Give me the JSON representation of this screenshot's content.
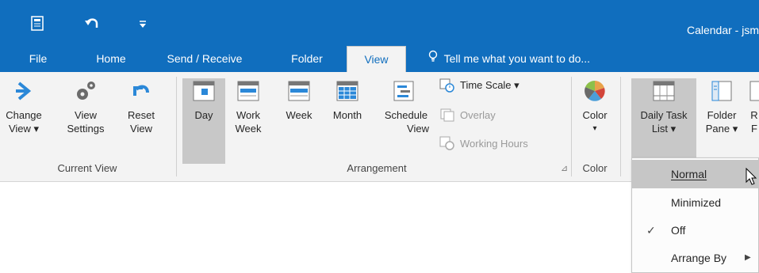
{
  "titlebar": {
    "window_title": "Calendar - jsm",
    "qat": [
      {
        "name": "send-receive-all-icon",
        "glyph": "▤"
      },
      {
        "name": "undo-icon",
        "glyph": "↶"
      },
      {
        "name": "customize-qat-icon",
        "glyph": "⩧"
      }
    ]
  },
  "tabs": [
    {
      "label": "File"
    },
    {
      "label": "Home"
    },
    {
      "label": "Send / Receive"
    },
    {
      "label": "Folder"
    },
    {
      "label": "View"
    }
  ],
  "tell_me": "Tell me what you want to do...",
  "ribbon": {
    "current_view": {
      "group_label": "Current View",
      "change_view": [
        "Change",
        "View ▾"
      ],
      "view_settings": [
        "View",
        "Settings"
      ],
      "reset_view": [
        "Reset",
        "View"
      ]
    },
    "arrangement": {
      "group_label": "Arrangement",
      "day": "Day",
      "work_week": [
        "Work",
        "Week"
      ],
      "week": "Week",
      "month": "Month",
      "schedule_view": [
        "Schedule",
        "View"
      ],
      "time_scale": "Time Scale ▾",
      "overlay": "Overlay",
      "working_hours": "Working Hours",
      "launcher": "⊿"
    },
    "color": {
      "group_label": "Color",
      "color_btn": "Color",
      "caret": "▾"
    },
    "layout": {
      "daily_task_list": [
        "Daily Task",
        "List ▾"
      ],
      "folder_pane": [
        "Folder",
        "Pane ▾"
      ],
      "reading_pane_partial": [
        "R",
        "F"
      ]
    }
  },
  "menu": {
    "items": [
      {
        "label": "Normal",
        "state": "hover"
      },
      {
        "label": "Minimized",
        "state": ""
      },
      {
        "label": "Off",
        "state": "checked",
        "check": "✓"
      },
      {
        "label": "Arrange By",
        "state": "submenu",
        "arrow": "▶"
      }
    ]
  },
  "colors": {
    "accent": "#106ebe",
    "ribbon_bg": "#f3f3f3",
    "selected_bg": "#c8c8c8"
  }
}
